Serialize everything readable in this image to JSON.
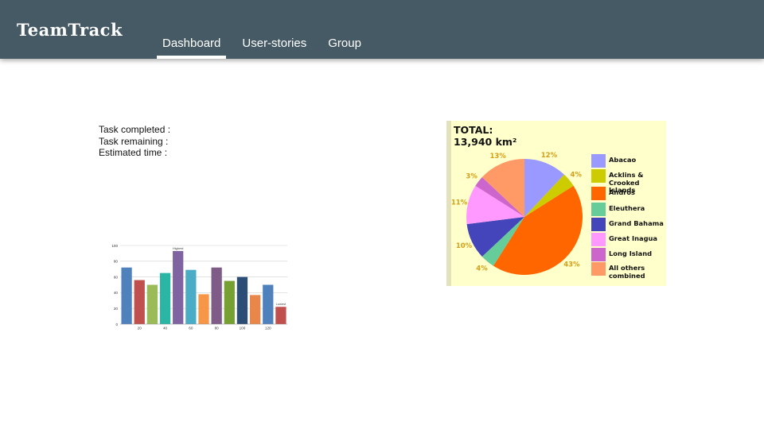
{
  "app": {
    "title": "TeamTrack"
  },
  "nav": {
    "tabs": [
      {
        "label": "Dashboard",
        "active": true
      },
      {
        "label": "User-stories",
        "active": false
      },
      {
        "label": "Group",
        "active": false
      }
    ]
  },
  "stats": {
    "task_completed_label": "Task completed :",
    "task_remaining_label": "Task remaining :",
    "estimated_time_label": "Estimated time :"
  },
  "chart_data": [
    {
      "type": "bar",
      "ylim": [
        0,
        100
      ],
      "yticks": [
        "0",
        "20",
        "40",
        "60",
        "80",
        "100"
      ],
      "xticks": [
        "20",
        "40",
        "60",
        "80",
        "100",
        "120"
      ],
      "values": [
        72,
        56,
        50,
        65,
        93,
        69,
        38,
        72,
        55,
        60,
        37,
        50,
        22
      ],
      "colors": [
        "#4f81bd",
        "#c0504d",
        "#9bbb59",
        "#2ab5a5",
        "#8064a2",
        "#4bacc6",
        "#f79646",
        "#7e5c87",
        "#77a033",
        "#2c4d75",
        "#e9874a",
        "#4f81bd",
        "#c0504d"
      ],
      "annotations": [
        {
          "text": "Highest",
          "bar_index": 4
        },
        {
          "text": "Lowest",
          "bar_index": 12
        }
      ],
      "grid": true,
      "legend": "none"
    },
    {
      "type": "pie",
      "title": "TOTAL:",
      "subtitle": "13,940 km²",
      "slices": [
        {
          "label": "Abacao",
          "value": 12,
          "pct_label": "12%",
          "color": "#9999ff"
        },
        {
          "label": "Acklins &\nCrooked Islands",
          "value": 4,
          "pct_label": "4%",
          "color": "#cccc00"
        },
        {
          "label": "Andros",
          "value": 43,
          "pct_label": "43%",
          "color": "#ff6600"
        },
        {
          "label": "Eleuthera",
          "value": 4,
          "pct_label": "4%",
          "color": "#66cc99"
        },
        {
          "label": "Grand Bahama",
          "value": 10,
          "pct_label": "10%",
          "color": "#4444bb"
        },
        {
          "label": "Great Inagua",
          "value": 11,
          "pct_label": "11%",
          "color": "#ff99ff"
        },
        {
          "label": "Long Island",
          "value": 3,
          "pct_label": "3%",
          "color": "#cc66cc"
        },
        {
          "label": "All others\ncombined",
          "value": 13,
          "pct_label": "13%",
          "color": "#ff9966"
        }
      ],
      "legend": "right"
    }
  ]
}
